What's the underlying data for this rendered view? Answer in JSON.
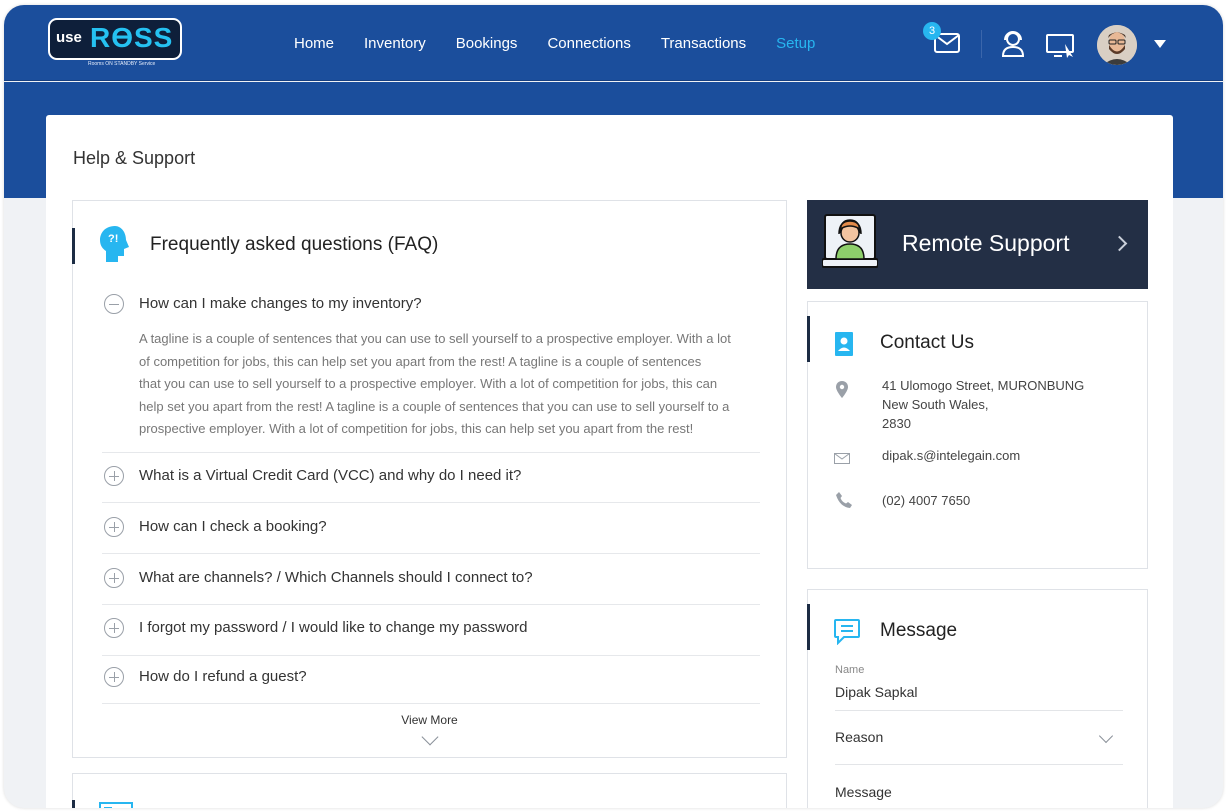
{
  "header": {
    "logo_use": "use",
    "logo_ross": "RϴSS",
    "logo_tagline": "Rooms ON STANDBY Service",
    "nav": [
      "Home",
      "Inventory",
      "Bookings",
      "Connections",
      "Transactions",
      "Setup"
    ],
    "active_nav": "Setup",
    "mail_badge": "3"
  },
  "page": {
    "title": "Help & Support"
  },
  "faq": {
    "title": "Frequently asked questions (FAQ)",
    "questions": [
      "How can I make changes to my inventory?",
      "What is a Virtual Credit Card (VCC) and why do I need it?",
      "How can I check a booking?",
      "What are channels? / Which Channels should I connect to?",
      "I forgot my password / I would like to change my password",
      "How do I refund a guest?"
    ],
    "answer_lines": [
      "A tagline is a couple of sentences that you can use to sell yourself to a prospective employer. With a lot",
      "of competition for jobs, this can help set you apart from the rest!  A tagline is a couple of sentences",
      "that you can use to sell yourself to a prospective employer. With a lot of competition for jobs, this can",
      "help set you apart from the rest! A tagline is a couple of sentences that you can use to sell yourself to a",
      "prospective employer. With a lot of competition for jobs, this can help set you apart from the rest!"
    ],
    "view_more": "View More"
  },
  "remote": {
    "title": "Remote Support"
  },
  "contact": {
    "title": "Contact Us",
    "address_lines": [
      "41 Ulomogo Street, MURONBUNG",
      "New South Wales,",
      "2830"
    ],
    "email": "dipak.s@intelegain.com",
    "phone": "(02) 4007 7650"
  },
  "message": {
    "title": "Message",
    "name_label": "Name",
    "name_value": "Dipak Sapkal",
    "reason_label": "Reason",
    "message_label": "Message"
  },
  "colors": {
    "nav_bg": "#1b4e9c",
    "active": "#27b6f0",
    "dark_card": "#232f45",
    "icon_blue": "#27b6f0"
  }
}
